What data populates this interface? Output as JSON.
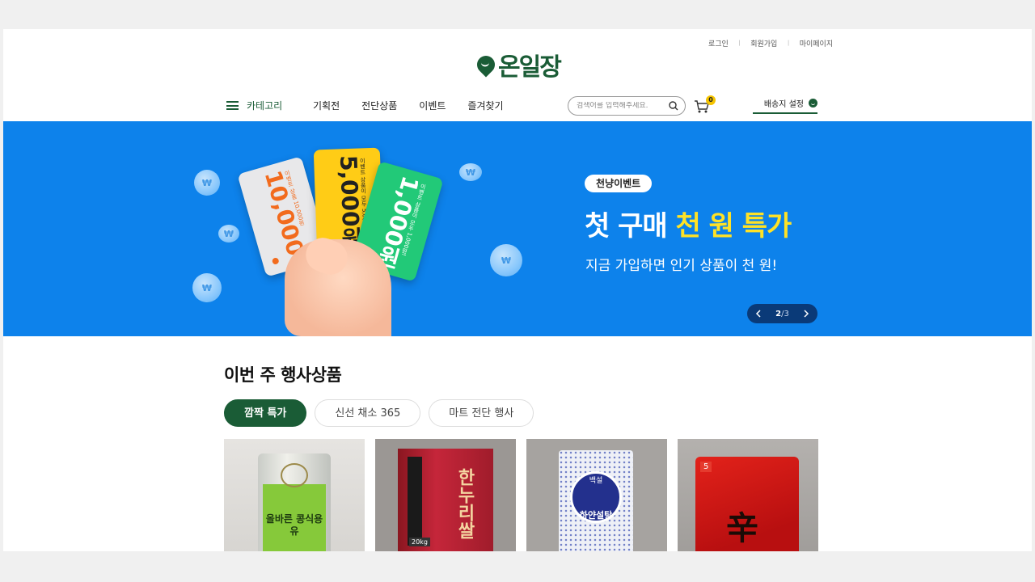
{
  "util_links": [
    "로그인",
    "회원가입",
    "마이페이지"
  ],
  "logo": {
    "text": "온일장"
  },
  "nav": {
    "category": "카테고리",
    "menu": [
      "기획전",
      "전단상품",
      "이벤트",
      "즐겨찾기"
    ],
    "search_placeholder": "검색어를 입력해주세요.",
    "cart_count": "0",
    "delivery": "배송지 설정"
  },
  "banner": {
    "chip": "천냥이벤트",
    "headline_pre": "첫 구매 ",
    "headline_highlight": "천 원 특가",
    "sub": "지금 가입하면 인기 상품이 천 원!",
    "page_current": "2",
    "page_sep": "/",
    "page_total": "3",
    "cards": [
      {
        "amount": "10,000원",
        "fine": "이벤트 상품 10,000원",
        "color": "#e8e8ea",
        "text": "#f26b1d"
      },
      {
        "amount": "5,000원",
        "fine": "이벤트 상품이 모두 5,000원!",
        "color": "#ffcc16",
        "text": "#222222"
      },
      {
        "amount": "1,000원",
        "fine": "이벤트 상품이 모두 1,000원!",
        "color": "#22c978",
        "text": "#ffffff"
      }
    ]
  },
  "section": {
    "title": "이번 주 행사상품",
    "tabs": [
      "깜짝 특가",
      "신선 채소 365",
      "마트 전단 행사"
    ]
  },
  "products": [
    {
      "label": "올바른 콩식용유"
    },
    {
      "label": "한누리쌀",
      "tag": "20kg"
    },
    {
      "label": "하얀설탕",
      "badge": "백설"
    },
    {
      "label": "辛",
      "top": "5"
    }
  ],
  "colors": {
    "brand": "#1a5c36",
    "banner": "#0d82eb",
    "highlight": "#ffe226"
  }
}
